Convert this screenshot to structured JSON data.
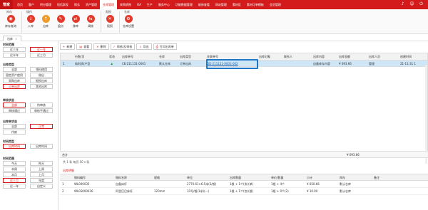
{
  "brand": {
    "logo_text": "管家"
  },
  "nav": [
    "首页",
    "客户",
    "积分管理",
    "短信群发",
    "财务",
    "资产管理",
    "仓库管理",
    "采购销售",
    "OA",
    "生产",
    "服务中心",
    "功能数据管理",
    "维修查看",
    "网站管理",
    "素材区",
    "素材订单模板",
    "会员管理"
  ],
  "nav_active_index": 6,
  "ribbon": {
    "groups": [
      {
        "title": "库存",
        "buttons": [
          "库存查询"
        ]
      },
      {
        "title": "操作",
        "buttons": [
          "入库",
          "出库",
          "盘点",
          "移库",
          "调拨"
        ]
      },
      {
        "title": "报损",
        "buttons": [
          "报损"
        ]
      },
      {
        "title": "仓库",
        "buttons": [
          "仓库设置"
        ]
      }
    ]
  },
  "tab": {
    "label": "出库",
    "close": "×"
  },
  "sidebar": {
    "sections": [
      {
        "title": "时间范围",
        "options": [
          "近三年",
          "近一年",
          "近半年",
          "近三月"
        ],
        "selected": 1
      },
      {
        "title": "出库类型",
        "options": [
          "全部",
          "领料使用",
          "固定资产使用",
          "借出",
          "采购出库",
          "报损出库",
          "订单出库",
          "其他出库"
        ],
        "selected": 6
      },
      {
        "title": "审核状态",
        "options": [
          "全部",
          "待审核",
          "审核通过",
          "审核不通过"
        ],
        "selected": 0
      },
      {
        "title": "出库单状态",
        "options": [
          "全部",
          "正常",
          "作废"
        ],
        "selected": 1
      },
      {
        "title": "时间类型",
        "options": [
          "出库时间",
          "出库时间"
        ],
        "selected": 0
      },
      {
        "title": "时间范围",
        "options": [
          "今天",
          "昨天",
          "本周",
          "上周",
          "本月",
          "上月",
          "近三月",
          "年度",
          "近一年",
          "自定义"
        ],
        "selected": 6
      }
    ]
  },
  "toolbar": [
    "新建",
    "查看",
    "删除",
    "审核/反审核",
    "导出",
    "打印出库单"
  ],
  "grid": {
    "headers": [
      "",
      "行数/页",
      "状态",
      "出库单号",
      "仓库",
      "出库类型",
      "关联单号",
      "出库对象",
      "联系人",
      "出库内容",
      "出库金额",
      "出库人员",
      "创建时间"
    ],
    "rows": [
      [
        "1",
        "纯利润/户型",
        "",
        "CK-211131-0001",
        "默认仓库",
        "订单出库",
        "DD-211131-0001-002",
        "",
        "",
        "自备库存内容",
        "¥ 693.66",
        "管理",
        "21-11-31 1"
      ]
    ],
    "sum_label": "合计",
    "sum_value": "¥ 693.66"
  },
  "pager": {
    "text": "共 1 条  每页 50 ▾ 条"
  },
  "detail": {
    "tab": "出库明细",
    "headers": [
      "",
      "物料编号",
      "物料名称",
      "规格",
      "单位",
      "出库数量",
      "单价/数量",
      "小计",
      "库存",
      "备注"
    ],
    "rows": [
      [
        "1",
        "WL000035",
        "自备床杆",
        "",
        "2770.61×6.5米(3/根)",
        "1根 + 1个(系)(单)",
        "1根 + 4个",
        "¥ 650.66",
        "默认仓库",
        ""
      ],
      [
        "2",
        "WL0S000036",
        "阿里巴巴床杆",
        "120mm",
        "10号/根(1米)(一)",
        "1根 + 1个(包)(根)",
        "1根 + 0个(2)",
        "¥ 10.00",
        "默认仓库",
        ""
      ]
    ]
  },
  "colors": {
    "brand": "#d41b1b",
    "selected_row": "#cfe6f7",
    "highlight_border": "#1f77c8"
  }
}
